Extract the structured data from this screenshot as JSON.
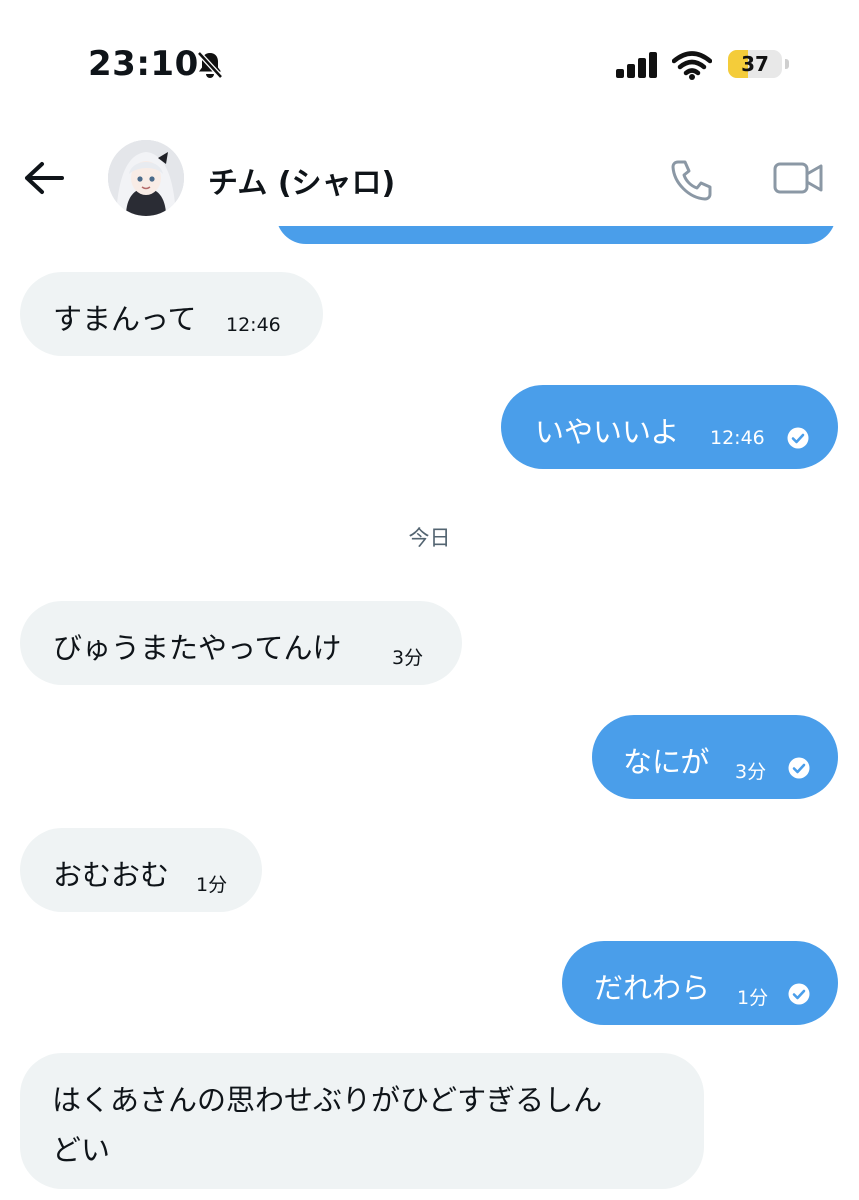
{
  "status_bar": {
    "time": "23:10",
    "battery": "37",
    "battery_level": 0.37,
    "icons": [
      "bell-slash-icon",
      "signal-icon",
      "wifi-icon",
      "battery-icon"
    ]
  },
  "header": {
    "contact_name": "チム (シャロ)",
    "icons": [
      "back-arrow-icon",
      "phone-icon",
      "video-icon"
    ]
  },
  "messages": [
    {
      "direction": "received",
      "text": "すまんって",
      "time": "12:46"
    },
    {
      "direction": "sent",
      "text": "いやいいよ",
      "time": "12:46",
      "status": "read"
    },
    {
      "type": "date-separator",
      "text": "今日"
    },
    {
      "direction": "received",
      "text": "びゅうまたやってんけ",
      "time": "3分"
    },
    {
      "direction": "sent",
      "text": "なにが",
      "time": "3分",
      "status": "read"
    },
    {
      "direction": "received",
      "text": "おむおむ",
      "time": "1分"
    },
    {
      "direction": "sent",
      "text": "だれわら",
      "time": "1分",
      "status": "read"
    },
    {
      "direction": "received",
      "text_line1": "はくあさんの思わせぶりがひどすぎるしん",
      "text_line2": "どい"
    }
  ],
  "colors": {
    "sent_bubble": "#4a9eea",
    "received_bubble": "#eff3f4",
    "text": "#0f1419",
    "secondary_text": "#536471",
    "battery_fill": "#f4cc3a"
  }
}
